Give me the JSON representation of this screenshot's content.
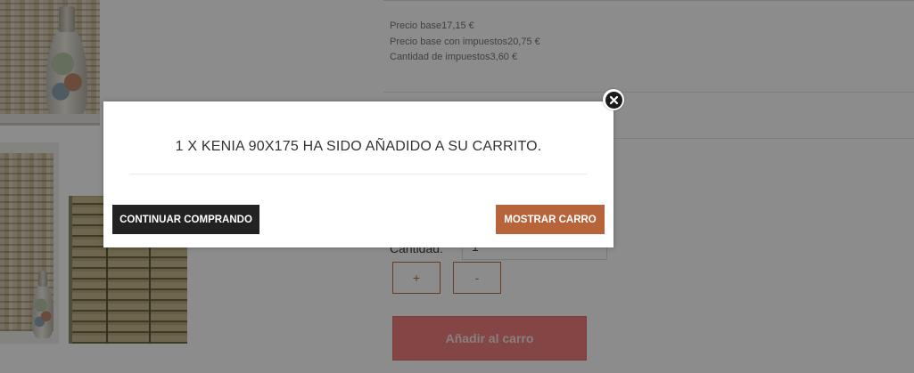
{
  "product": {
    "price_lines": [
      "Precio base17,15 €",
      "Precio base con impuestos20,75 €",
      "Cantidad de impuestos3,60 €"
    ],
    "quantity_label": "Cantidad:",
    "quantity_value": "1",
    "plus_label": "+",
    "minus_label": "-",
    "add_to_cart_label": "Añadir al carro"
  },
  "modal": {
    "message": "1 X KENIA 90X175 HA SIDO AÑADIDO A SU CARRITO.",
    "continue_label": "CONTINUAR COMPRANDO",
    "show_cart_label": "MOSTRAR CARRO",
    "close_icon": "close-icon"
  },
  "colors": {
    "continue_button": "#222222",
    "show_cart_button": "#b7643a",
    "add_to_cart_button": "#f07f7f",
    "accent_border": "#c0703f"
  }
}
